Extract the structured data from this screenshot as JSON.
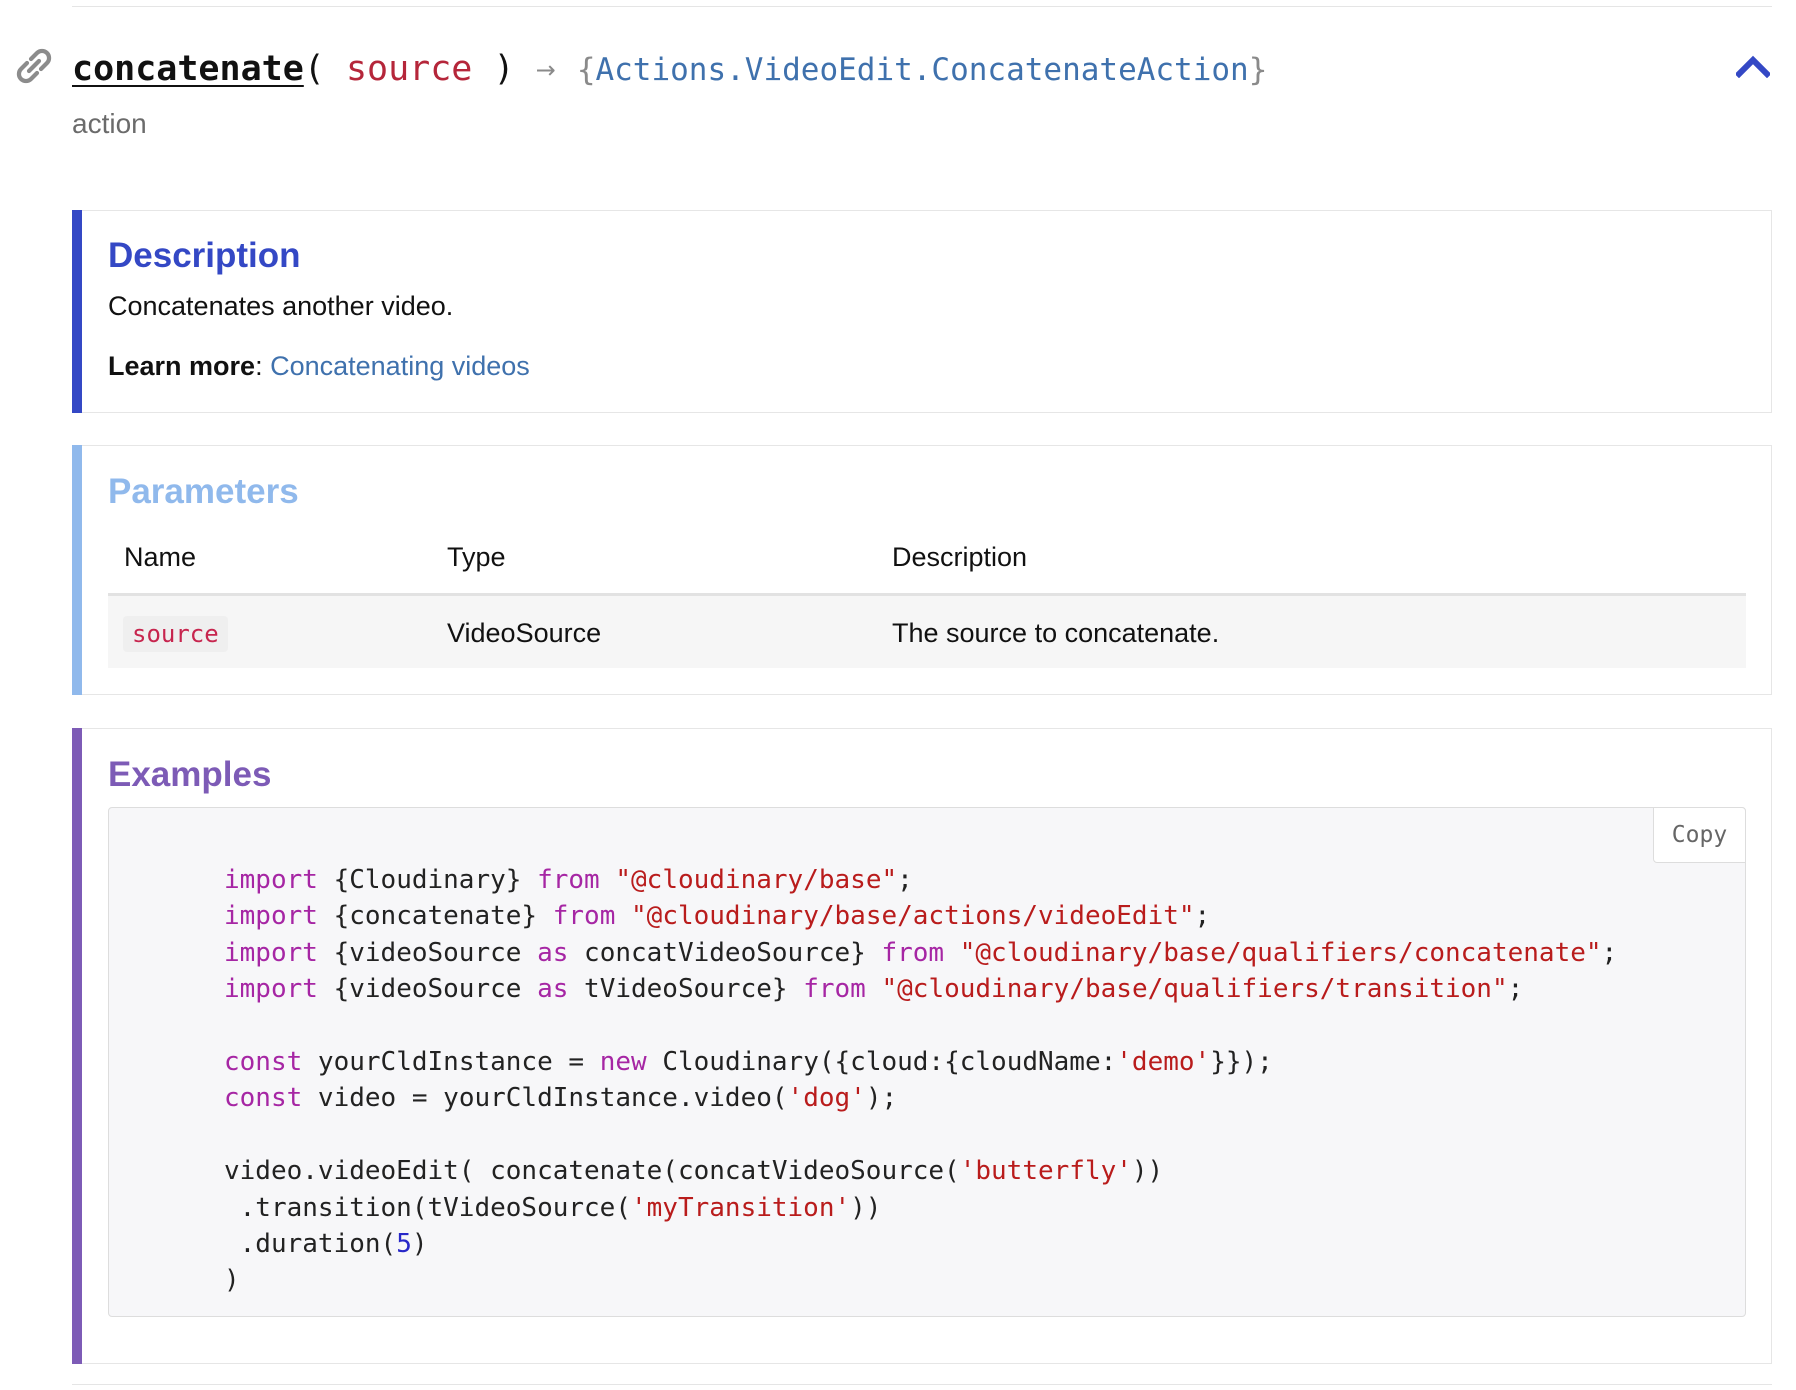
{
  "header": {
    "function_name": "concatenate",
    "open_paren": "(",
    "param_name": "source",
    "close_paren": ")",
    "arrow": "→",
    "return_open": "{",
    "return_type": "Actions.VideoEdit.ConcatenateAction",
    "return_close": "}",
    "kind": "action"
  },
  "icons": {
    "link": "link-icon",
    "collapse": "chevron-up-icon"
  },
  "colors": {
    "description_accent": "#3448c5",
    "parameters_accent": "#90b9ec",
    "examples_accent": "#7d5bb6",
    "link": "#3f71ad",
    "param_code": "#c7254e"
  },
  "description": {
    "title": "Description",
    "text": "Concatenates another video.",
    "learn_more_label": "Learn more",
    "learn_more_sep": ":",
    "learn_more_link": "Concatenating videos"
  },
  "parameters": {
    "title": "Parameters",
    "columns": [
      "Name",
      "Type",
      "Description"
    ],
    "rows": [
      {
        "name": "source",
        "type": "VideoSource",
        "description": "The source to concatenate."
      }
    ]
  },
  "examples": {
    "title": "Examples",
    "copy_label": "Copy",
    "code_lines": [
      [
        [
          "kw",
          "import"
        ],
        [
          "",
          " {Cloudinary} "
        ],
        [
          "kw",
          "from"
        ],
        [
          "",
          " "
        ],
        [
          "str",
          "\"@cloudinary/base\""
        ],
        [
          "",
          ";"
        ]
      ],
      [
        [
          "kw",
          "import"
        ],
        [
          "",
          " {concatenate} "
        ],
        [
          "kw",
          "from"
        ],
        [
          "",
          " "
        ],
        [
          "str",
          "\"@cloudinary/base/actions/videoEdit\""
        ],
        [
          "",
          ";"
        ]
      ],
      [
        [
          "kw",
          "import"
        ],
        [
          "",
          " {videoSource "
        ],
        [
          "kw",
          "as"
        ],
        [
          "",
          " concatVideoSource} "
        ],
        [
          "kw",
          "from"
        ],
        [
          "",
          " "
        ],
        [
          "str",
          "\"@cloudinary/base/qualifiers/concatenate\""
        ],
        [
          "",
          ";"
        ]
      ],
      [
        [
          "kw",
          "import"
        ],
        [
          "",
          " {videoSource "
        ],
        [
          "kw",
          "as"
        ],
        [
          "",
          " tVideoSource} "
        ],
        [
          "kw",
          "from"
        ],
        [
          "",
          " "
        ],
        [
          "str",
          "\"@cloudinary/base/qualifiers/transition\""
        ],
        [
          "",
          ";"
        ]
      ],
      [],
      [
        [
          "kw",
          "const"
        ],
        [
          "",
          " yourCldInstance = "
        ],
        [
          "kw",
          "new"
        ],
        [
          "",
          " Cloudinary({cloud:{cloudName:"
        ],
        [
          "str",
          "'demo'"
        ],
        [
          "",
          "}});"
        ]
      ],
      [
        [
          "kw",
          "const"
        ],
        [
          "",
          " video = yourCldInstance.video("
        ],
        [
          "str",
          "'dog'"
        ],
        [
          "",
          ");"
        ]
      ],
      [],
      [
        [
          "",
          "video.videoEdit( concatenate(concatVideoSource("
        ],
        [
          "str",
          "'butterfly'"
        ],
        [
          "",
          "))"
        ]
      ],
      [
        [
          "",
          " .transition(tVideoSource("
        ],
        [
          "str",
          "'myTransition'"
        ],
        [
          "",
          "))"
        ]
      ],
      [
        [
          "",
          " .duration("
        ],
        [
          "num",
          "5"
        ],
        [
          "",
          ")"
        ]
      ],
      [
        [
          "",
          ")"
        ]
      ]
    ]
  }
}
